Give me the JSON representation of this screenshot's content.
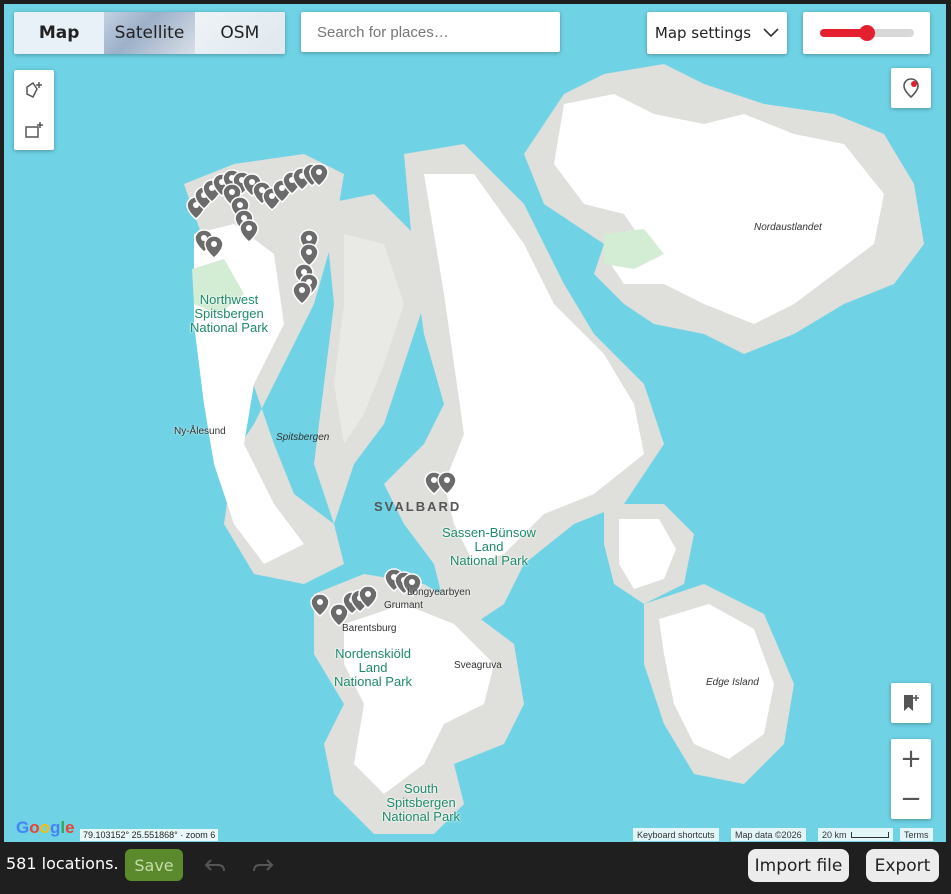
{
  "map_type": {
    "options": [
      "Map",
      "Satellite",
      "OSM"
    ],
    "selected": "Map"
  },
  "search": {
    "placeholder": "Search for places…"
  },
  "map_settings": {
    "label": "Map settings"
  },
  "opacity_slider": {
    "value_percent": 50,
    "accent": "#e5202e"
  },
  "labels": {
    "nw_park": "Northwest\nSpitsbergen\nNational Park",
    "nordaustlandet": "Nordaustlandet",
    "ny_alesund": "Ny-Ålesund",
    "spitsbergen": "Spitsbergen",
    "svalbard": "SVALBARD",
    "sassen_park": "Sassen-Bünsow\nLand\nNational Park",
    "longyearbyen": "Longyearbyen",
    "grumant": "Grumant",
    "barentsburg": "Barentsburg",
    "nordenskiold_park": "Nordenskiöld\nLand\nNational Park",
    "sveagruva": "Sveagruva",
    "edge_island": "Edge Island",
    "south_park": "South\nSpitsbergen\nNational Park"
  },
  "attribution": {
    "google": "Google",
    "coords": "79.103152° 25.551868° · zoom 6",
    "shortcuts": "Keyboard shortcuts",
    "map_data": "Map data ©2026",
    "scale": "20 km",
    "terms": "Terms"
  },
  "colors": {
    "water": "#6fd3e5",
    "land": "#dfe0dc",
    "ice": "#ffffff",
    "marker": "#6b6b6b"
  },
  "footer": {
    "count": "581 locations.",
    "save": "Save",
    "import": "Import file",
    "export": "Export"
  }
}
